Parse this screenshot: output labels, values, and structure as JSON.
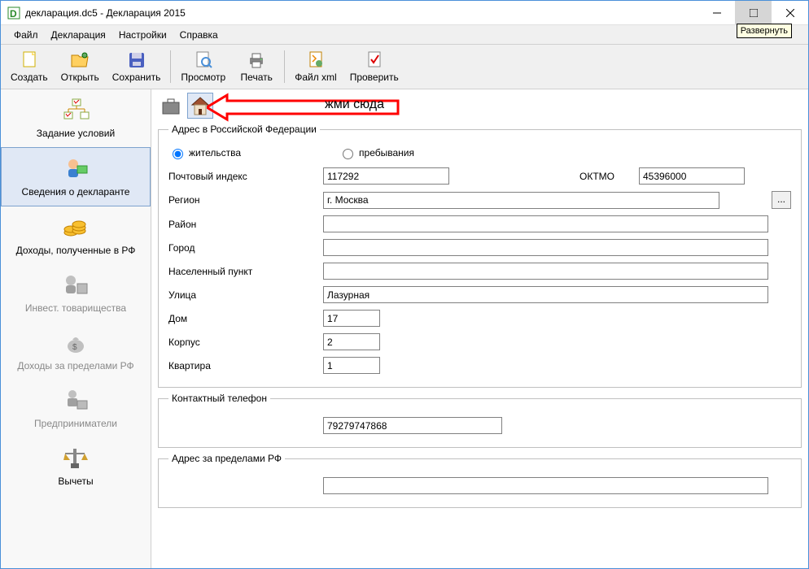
{
  "title": "декларация.dc5 - Декларация 2015",
  "tooltip": "Развернуть",
  "menu": [
    "Файл",
    "Декларация",
    "Настройки",
    "Справка"
  ],
  "toolbar": {
    "create": "Создать",
    "open": "Открыть",
    "save": "Сохранить",
    "preview": "Просмотр",
    "print": "Печать",
    "xml": "Файл xml",
    "check": "Проверить"
  },
  "sidebar": {
    "conditions": "Задание условий",
    "declarant": "Сведения о декларанте",
    "income_rf": "Доходы, полученные в РФ",
    "invest": "Инвест. товарищества",
    "income_foreign": "Доходы за пределами РФ",
    "entrepreneurs": "Предприниматели",
    "deductions": "Вычеты"
  },
  "annotation": "жми сюда",
  "form": {
    "address_rf_legend": "Адрес в Российской Федерации",
    "radio_residence": "жительства",
    "radio_stay": "пребывания",
    "postal_label": "Почтовый индекс",
    "postal_value": "117292",
    "oktmo_label": "ОКТМО",
    "oktmo_value": "45396000",
    "region_label": "Регион",
    "region_value": "г. Москва",
    "district_label": "Район",
    "district_value": "",
    "city_label": "Город",
    "city_value": "",
    "locality_label": "Населенный пункт",
    "locality_value": "",
    "street_label": "Улица",
    "street_value": "Лазурная",
    "house_label": "Дом",
    "house_value": "17",
    "building_label": "Корпус",
    "building_value": "2",
    "flat_label": "Квартира",
    "flat_value": "1",
    "phone_legend": "Контактный телефон",
    "phone_value": "79279747868",
    "address_foreign_legend": "Адрес за пределами РФ",
    "foreign_value": ""
  }
}
